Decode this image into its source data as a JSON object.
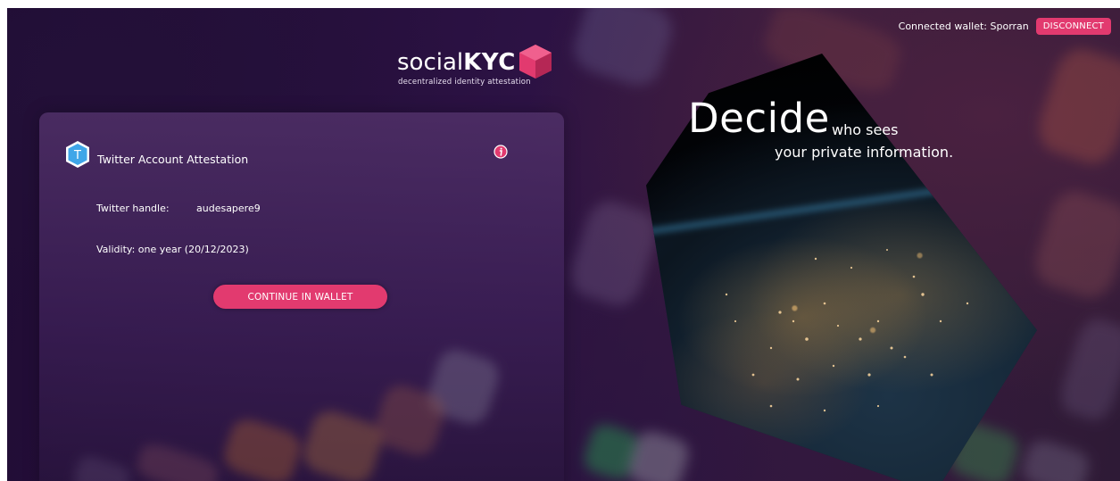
{
  "header": {
    "wallet_text": "Connected wallet: Sporran",
    "disconnect_label": "DISCONNECT"
  },
  "logo": {
    "word_light": "social",
    "word_bold": "KYC",
    "tagline": "decentralized identity attestation"
  },
  "card": {
    "icon_letter": "T",
    "title": "Twitter Account Attestation",
    "handle_label": "Twitter handle:",
    "handle_value": "audesapere9",
    "validity": "Validity: one year (20/12/2023)",
    "continue_label": "CONTINUE IN WALLET"
  },
  "hero": {
    "big": "Decide",
    "line1": "who sees",
    "line2": "your private information."
  },
  "colors": {
    "accent": "#e23a6f",
    "twitter_blue": "#3fa6e8",
    "background": "#2c1244"
  },
  "icons": [
    "twitter-hex-icon",
    "info-icon",
    "logo-cube-icon"
  ]
}
